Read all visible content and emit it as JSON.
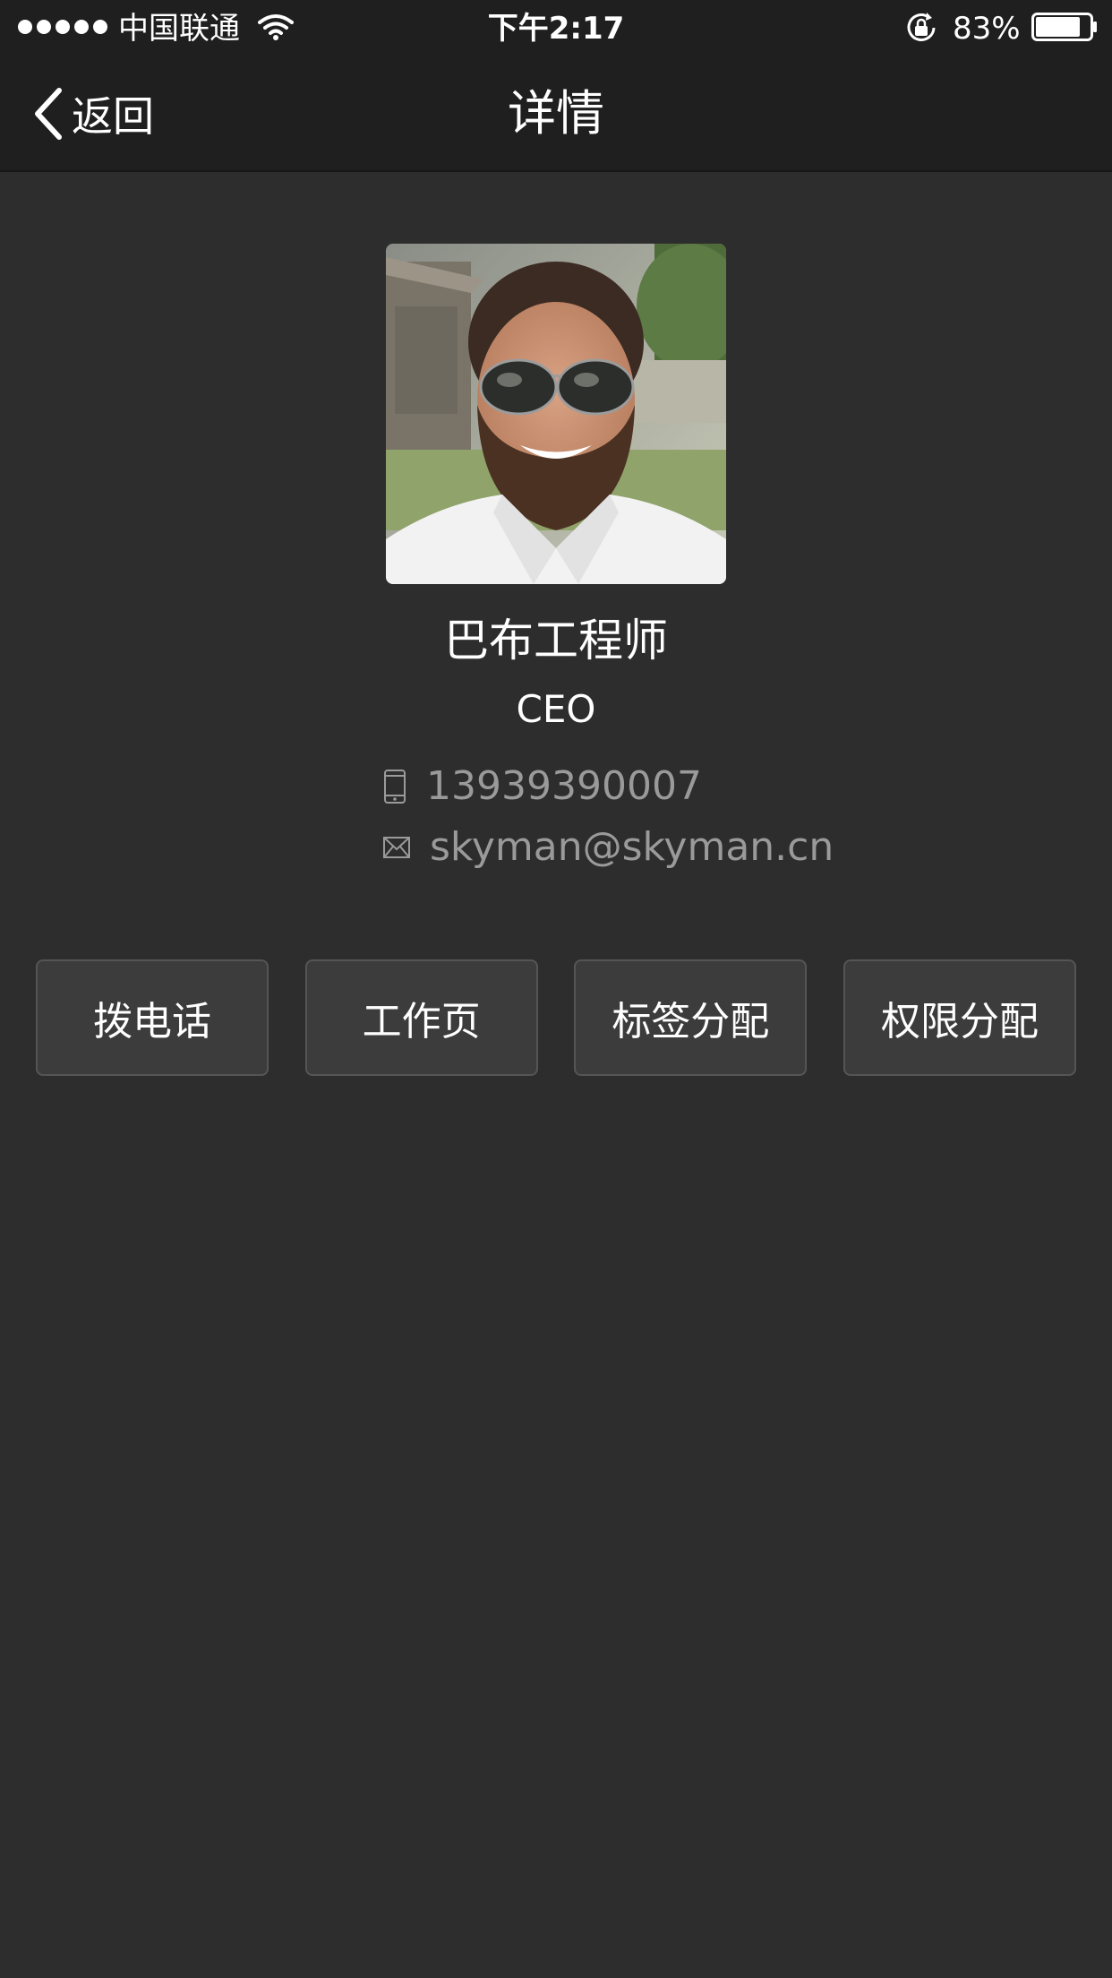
{
  "status_bar": {
    "carrier": "中国联通",
    "time": "下午2:17",
    "battery_percent": "83%",
    "battery_level": 0.83
  },
  "nav": {
    "back_label": "返回",
    "title": "详情"
  },
  "profile": {
    "name": "巴布工程师",
    "title": "CEO",
    "phone": "13939390007",
    "email": "skyman@skyman.cn"
  },
  "actions": [
    {
      "label": "拨电话"
    },
    {
      "label": "工作页"
    },
    {
      "label": "标签分配"
    },
    {
      "label": "权限分配"
    }
  ],
  "colors": {
    "background": "#2d2d2d",
    "bar": "#1f1f1f",
    "button": "#3c3c3c",
    "muted_text": "#9a9a9a"
  },
  "icons": [
    "signal-dots-icon",
    "wifi-icon",
    "rotation-lock-icon",
    "battery-icon",
    "back-chevron-icon",
    "phone-icon",
    "mail-icon"
  ]
}
